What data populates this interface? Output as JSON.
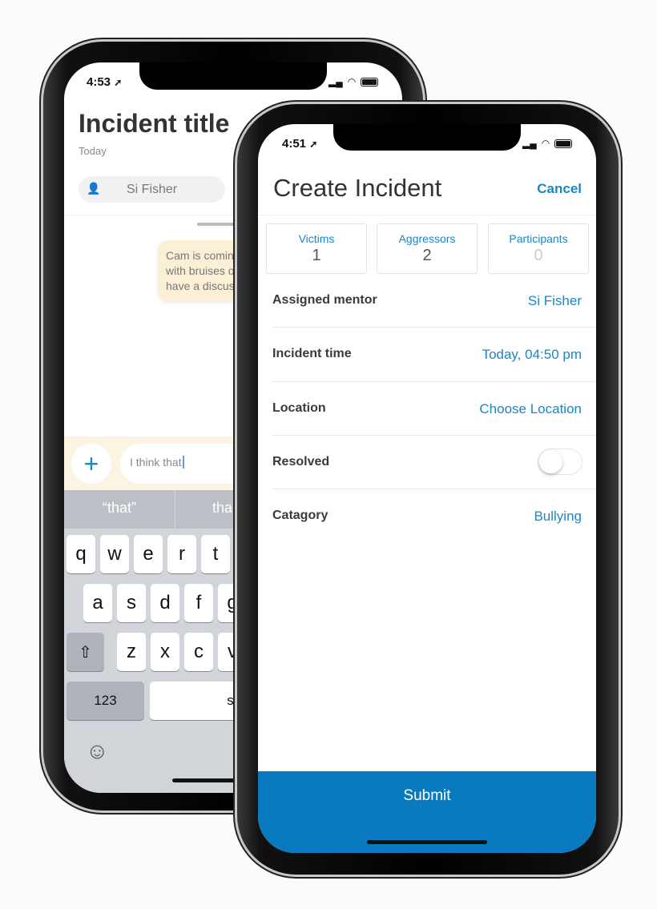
{
  "back_phone": {
    "status_time": "4:53",
    "title": "Incident title",
    "date": "Today",
    "mentor_pill": "Si Fisher",
    "message_lines": [
      "Cam is comin",
      "with bruises o",
      "have a discus"
    ],
    "input_value": "I think that",
    "suggestions": [
      "“that”",
      "tha"
    ],
    "keyboard": {
      "row1": [
        "q",
        "w",
        "e",
        "r",
        "t"
      ],
      "row2": [
        "a",
        "s",
        "d",
        "f",
        "g"
      ],
      "row3": [
        "z",
        "x",
        "c",
        "v"
      ],
      "numbers_key": "123",
      "space_key": "spa"
    },
    "icons": [
      "location-arrow-icon",
      "person-icon",
      "plus-icon",
      "shift-icon",
      "emoji-icon"
    ]
  },
  "front_phone": {
    "status_time": "4:51",
    "title": "Create Incident",
    "cancel": "Cancel",
    "counts": [
      {
        "label": "Victims",
        "value": "1"
      },
      {
        "label": "Aggressors",
        "value": "2"
      },
      {
        "label": "Participants",
        "value": "0"
      }
    ],
    "rows": [
      {
        "label": "Assigned mentor",
        "value": "Si Fisher"
      },
      {
        "label": "Incident time",
        "value": "Today, 04:50 pm"
      },
      {
        "label": "Location",
        "value": "Choose Location"
      },
      {
        "label": "Resolved",
        "toggle": false
      },
      {
        "label": "Catagory",
        "value": "Bullying"
      }
    ],
    "submit": "Submit",
    "colors": {
      "accent": "#1a87c5",
      "submit_bg": "#0a7ac0"
    }
  }
}
